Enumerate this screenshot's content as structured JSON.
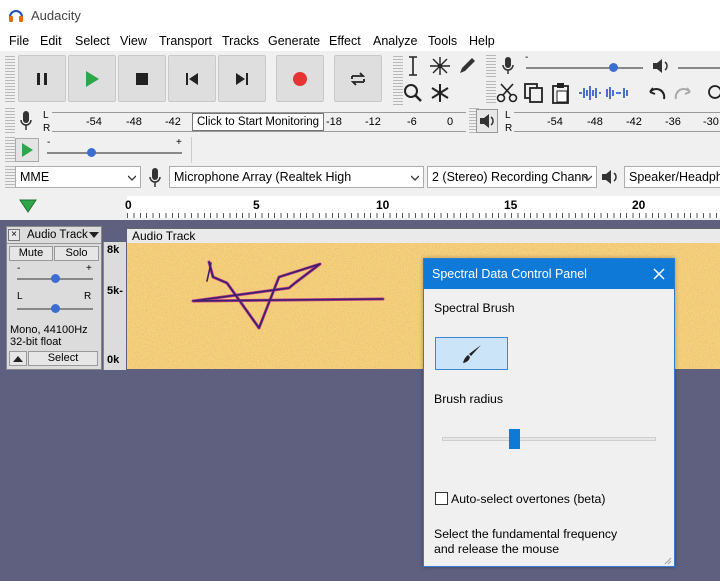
{
  "window": {
    "title": "Audacity"
  },
  "menu": [
    "File",
    "Edit",
    "Select",
    "View",
    "Transport",
    "Tracks",
    "Generate",
    "Effect",
    "Analyze",
    "Tools",
    "Help"
  ],
  "record_meter": {
    "ticks": [
      "-54",
      "-48",
      "-42",
      "-18",
      "-12",
      "-6",
      "0"
    ],
    "tooltip": "Click to Start Monitoring",
    "L": "L",
    "R": "R"
  },
  "playback_meter": {
    "ticks": [
      "-54",
      "-48",
      "-42",
      "-36",
      "-30"
    ],
    "L": "L",
    "R": "R"
  },
  "play_speed": {
    "minus": "-",
    "plus": "+"
  },
  "devices": {
    "host": "MME",
    "recording_device": "Microphone Array (Realtek High",
    "channels": "2 (Stereo) Recording Chann",
    "playback_device": "Speaker/Headpho"
  },
  "timeline": {
    "labels": [
      "0",
      "5",
      "10",
      "15",
      "20"
    ]
  },
  "track": {
    "name": "Audio Track",
    "mute": "Mute",
    "solo": "Solo",
    "gain_minus": "-",
    "gain_plus": "+",
    "pan_left": "L",
    "pan_right": "R",
    "info_line1": "Mono, 44100Hz",
    "info_line2": "32-bit float",
    "select": "Select",
    "clip_name": "Audio Track",
    "scale": [
      "8k",
      "5k-",
      "0k"
    ]
  },
  "spectral_panel": {
    "title": "Spectral Data Control Panel",
    "section": "Spectral Brush",
    "brush_radius_label": "Brush radius",
    "brush_radius": 0.33,
    "overtones_label": "Auto-select overtones (beta)",
    "overtones_checked": false,
    "instruction_line1": "Select the fundamental frequency",
    "instruction_line2": "and release the mouse"
  }
}
